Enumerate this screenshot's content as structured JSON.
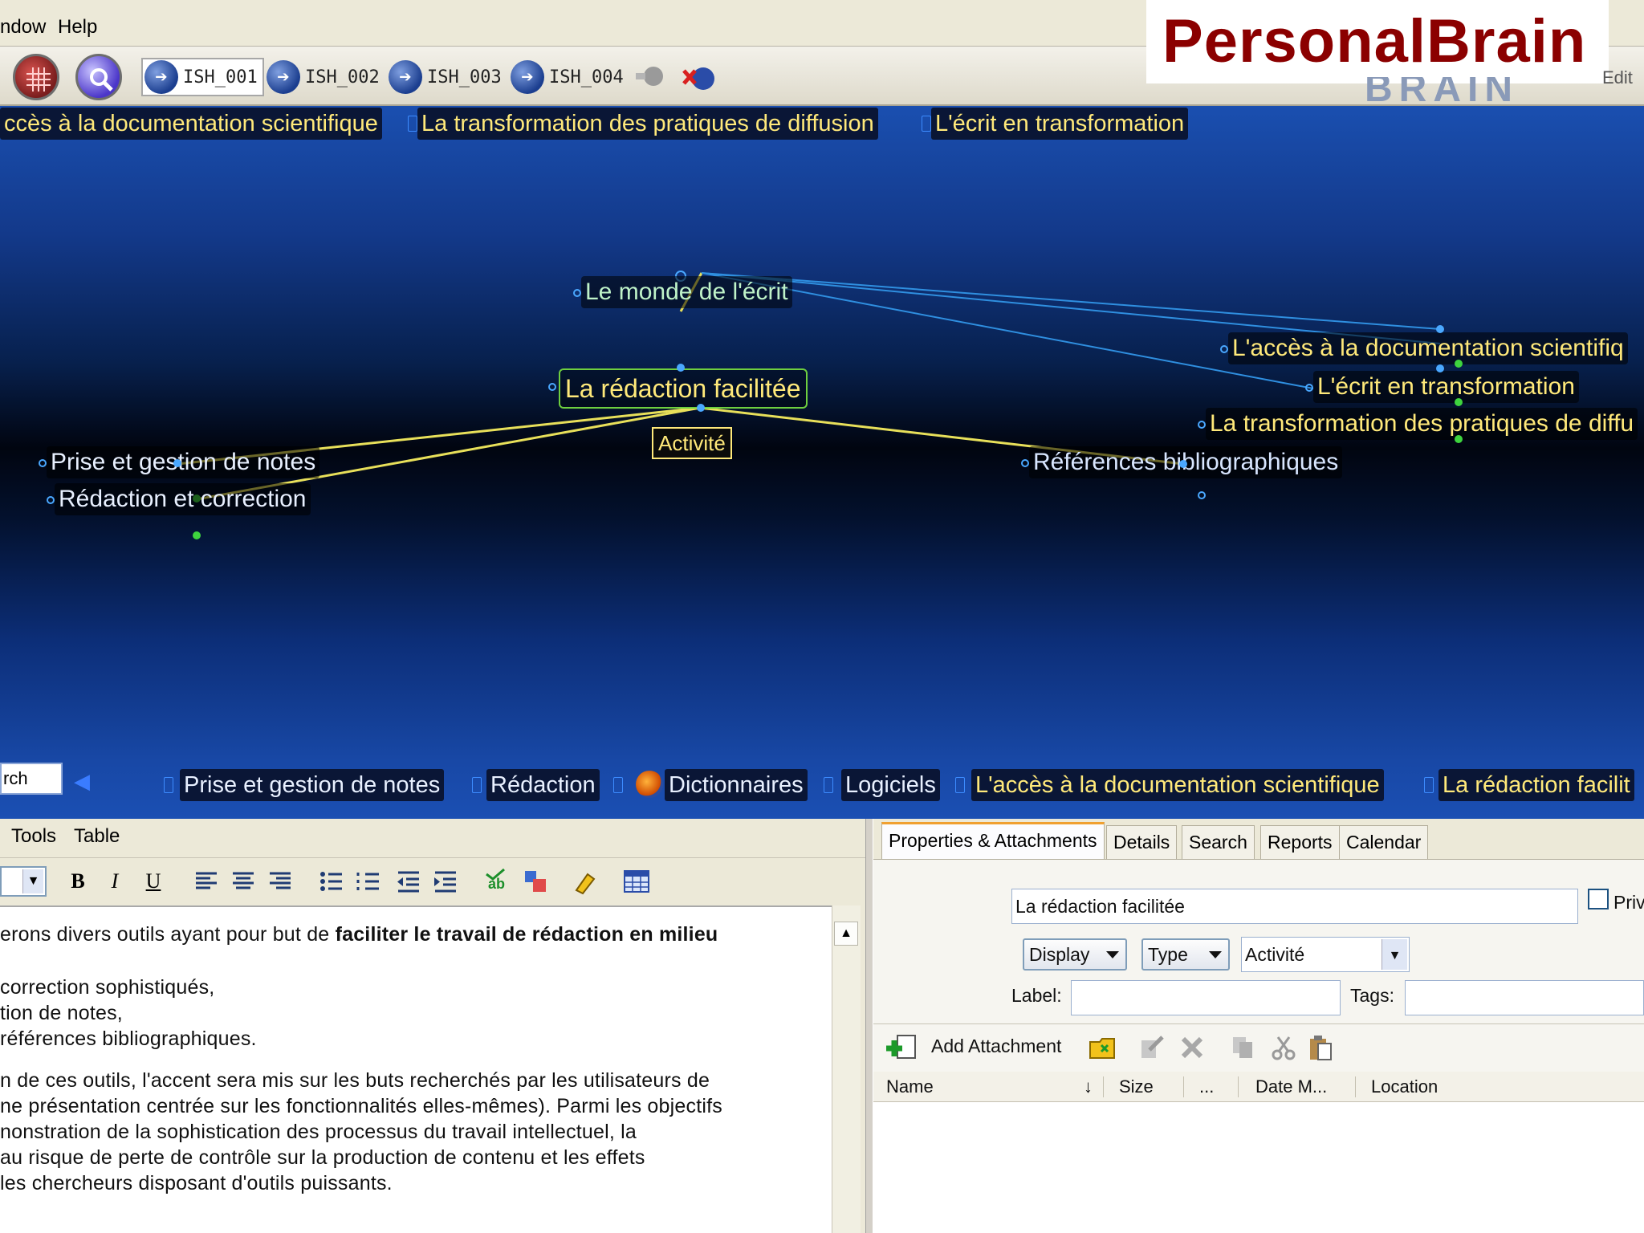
{
  "menubar": {
    "items": [
      "ndow",
      "Help"
    ]
  },
  "toolbar": {
    "brains": [
      {
        "label": "ISH_001",
        "active": true
      },
      {
        "label": "ISH_002",
        "active": false
      },
      {
        "label": "ISH_003",
        "active": false
      },
      {
        "label": "ISH_004",
        "active": false
      }
    ],
    "edit_hint": "Edit"
  },
  "logo": {
    "text": "PersonalBrain",
    "ghost": "BRAIN"
  },
  "plex": {
    "top_pins": [
      "ccès à la documentation scientifique",
      "La transformation des pratiques de diffusion",
      "L'écrit en transformation"
    ],
    "parent": "Le monde de l'écrit",
    "active": "La rédaction facilitée",
    "type_badge": "Activité",
    "children": [
      "Prise et gestion de notes",
      "Rédaction et correction",
      "Références bibliographiques"
    ],
    "jumps": [
      "L'accès à la documentation scientifiq",
      "L'écrit en transformation",
      "La transformation des pratiques de diffu"
    ],
    "search_value": "rch",
    "bottom_pins": [
      "Prise et gestion de notes",
      "Rédaction",
      "Dictionnaires",
      "Logiciels",
      "L'accès à la documentation scientifique",
      "La rédaction facilit"
    ],
    "colors": {
      "pin_text": "#ffe97a",
      "active_border": "#6ecf3f",
      "link_yellow": "#e8e05a",
      "link_blue": "#2f8fe0"
    }
  },
  "notes": {
    "menu": [
      "Tools",
      "Table"
    ],
    "format_buttons": [
      "B",
      "I",
      "U"
    ],
    "icons": [
      "align-left-icon",
      "align-center-icon",
      "align-right-icon",
      "bulleted-list-icon",
      "numbered-list-icon",
      "outdent-icon",
      "indent-icon",
      "spellcheck-icon",
      "color-icon",
      "highlight-icon",
      "table-icon"
    ],
    "lines": [
      {
        "pre": "erons divers outils ayant pour but de ",
        "bold": "faciliter le travail de rédaction en milieu"
      },
      {
        "pre": "correction sophistiqués,",
        "bold": ""
      },
      {
        "pre": "tion de notes,",
        "bold": ""
      },
      {
        "pre": "références bibliographiques.",
        "bold": ""
      },
      {
        "pre": "n de ces outils, l'accent sera mis sur les buts recherchés par les utilisateurs de",
        "bold": ""
      },
      {
        "pre": "ne présentation centrée sur les fonctionnalités elles-mêmes). Parmi les objectifs",
        "bold": ""
      },
      {
        "pre": "nonstration de la sophistication des processus du travail intellectuel, la",
        "bold": ""
      },
      {
        "pre": "au risque de perte de contrôle sur la production de contenu et les effets",
        "bold": ""
      },
      {
        "pre": "les chercheurs disposant d'outils puissants.",
        "bold": ""
      }
    ]
  },
  "props": {
    "tabs": [
      "Properties & Attachments",
      "Details",
      "Search",
      "Reports",
      "Calendar"
    ],
    "name_value": "La rédaction facilitée",
    "private_label": "Priv",
    "display_label": "Display",
    "type_label": "Type",
    "type_value": "Activité",
    "label_label": "Label:",
    "label_value": "",
    "tags_label": "Tags:",
    "tags_value": "",
    "add_attachment": "Add Attachment",
    "columns": [
      "Name",
      "Size",
      "...",
      "Date M...",
      "Location"
    ]
  }
}
